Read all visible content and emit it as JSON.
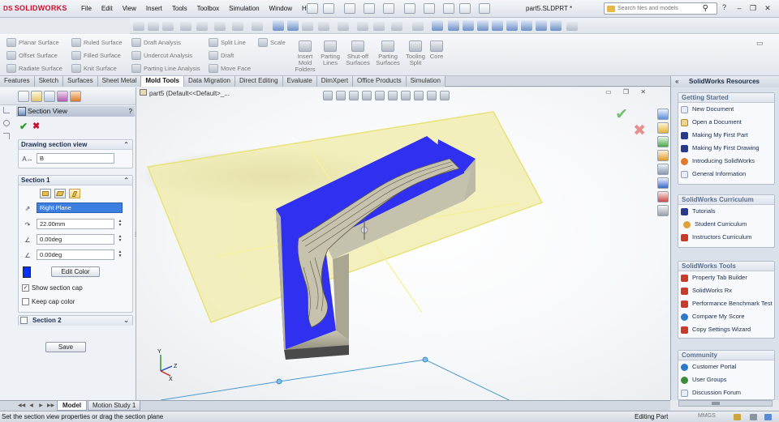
{
  "app": {
    "logo": "SOLIDWORKS",
    "file_title": "part5.SLDPRT *"
  },
  "menu": [
    "File",
    "Edit",
    "View",
    "Insert",
    "Tools",
    "Toolbox",
    "Simulation",
    "Window",
    "Help"
  ],
  "search": {
    "placeholder": "Search files and models",
    "help": "?"
  },
  "command_manager": {
    "col1": [
      "Planar Surface",
      "Offset Surface",
      "Radiate Surface"
    ],
    "col2": [
      "Ruled Surface",
      "Filled Surface",
      "Knit Surface"
    ],
    "col3": [
      "Draft Analysis",
      "Undercut Analysis",
      "Parting Line Analysis"
    ],
    "col4": [
      "Split Line",
      "Draft",
      "Move Face"
    ],
    "scale": "Scale",
    "big": [
      "Insert Mold Folders",
      "Parting Lines",
      "Shut-off Surfaces",
      "Parting Surfaces",
      "Tooling Split",
      "Core"
    ]
  },
  "tabs": [
    "Features",
    "Sketch",
    "Surfaces",
    "Sheet Metal",
    "Mold Tools",
    "Data Migration",
    "Direct Editing",
    "Evaluate",
    "DimXpert",
    "Office Products",
    "Simulation"
  ],
  "active_tab": "Mold Tools",
  "property_manager": {
    "title": "Section View",
    "help": "?",
    "drawing_group": {
      "title": "Drawing section view",
      "value": "B"
    },
    "section1": {
      "title": "Section 1",
      "plane": "Right Plane",
      "offset": "22.00mm",
      "angle1": "0.00deg",
      "angle2": "0.00deg",
      "edit_color": "Edit Color",
      "show_cap": "Show section cap",
      "keep_cap": "Keep cap color",
      "cap_color": "#0033ff"
    },
    "section2": {
      "title": "Section 2"
    },
    "save": "Save"
  },
  "viewport": {
    "tree_flyout": "part5  (Default<<Default>_...",
    "triad": {
      "y": "Y",
      "z": "Z",
      "x": "X"
    }
  },
  "task_pane": {
    "title": "SolidWorks Resources",
    "getting_started": {
      "title": "Getting Started",
      "items": [
        "New Document",
        "Open a Document",
        "Making My First Part",
        "Making My First Drawing",
        "Introducing SolidWorks",
        "General Information"
      ]
    },
    "curriculum": {
      "title": "SolidWorks Curriculum",
      "items": [
        "Tutorials",
        "Student Curriculum",
        "Instructors Curriculum"
      ]
    },
    "tools": {
      "title": "SolidWorks Tools",
      "items": [
        "Property Tab Builder",
        "SolidWorks Rx",
        "Performance Benchmark Test",
        "Compare My Score",
        "Copy Settings Wizard"
      ]
    },
    "community": {
      "title": "Community",
      "items": [
        "Customer Portal",
        "User Groups",
        "Discussion Forum"
      ]
    }
  },
  "bottom_tabs": {
    "model": "Model",
    "motion": "Motion Study 1"
  },
  "status": {
    "text": "Set the section view properties or drag the section plane",
    "mode": "Editing Part",
    "units": "MMGS"
  },
  "colors": {
    "section_cap": "#0033ff",
    "plane": "#f0eba8",
    "accent_red": "#c8102e"
  }
}
